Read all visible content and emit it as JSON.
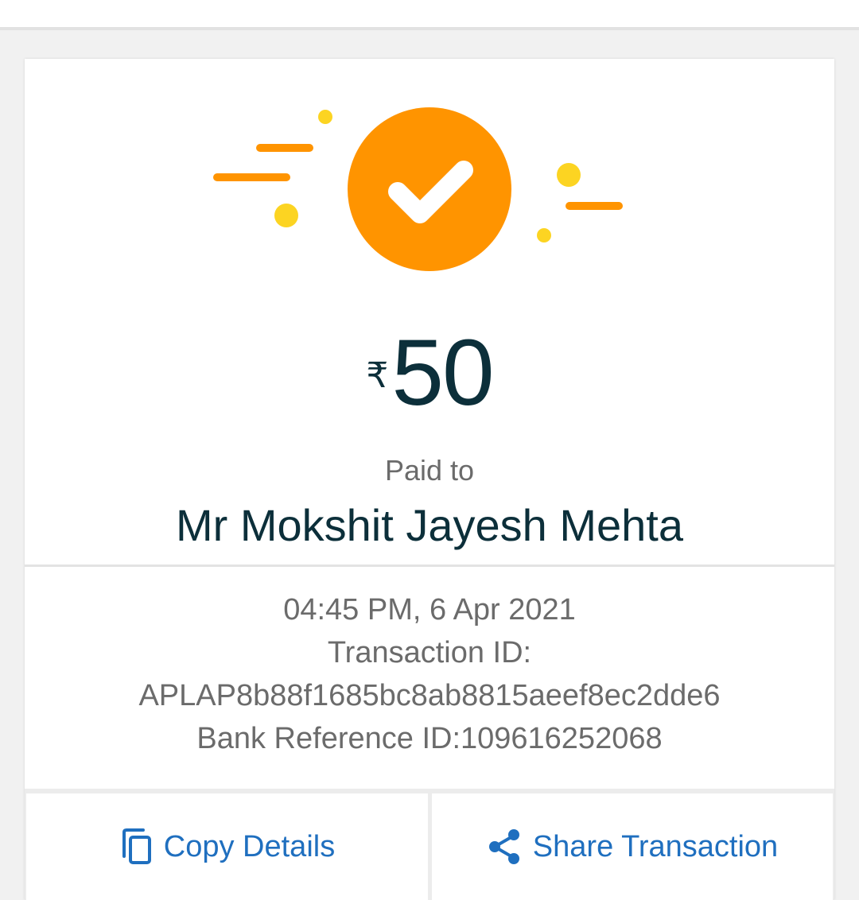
{
  "payment": {
    "currency_symbol": "₹",
    "amount": "50",
    "paid_label": "Paid to",
    "payee_name": "Mr Mokshit Jayesh Mehta"
  },
  "details": {
    "datetime": "04:45 PM, 6 Apr 2021",
    "transaction_label": "Transaction ID:",
    "transaction_id": "APLAP8b88f1685bc8ab8815aeef8ec2dde6",
    "bank_reference": "Bank Reference ID:109616252068"
  },
  "actions": {
    "copy_label": "Copy Details",
    "share_label": "Share Transaction",
    "copy_icon": "copy-icon",
    "share_icon": "share-icon"
  },
  "colors": {
    "success_orange": "#ff9400",
    "accent_yellow": "#fcd422",
    "link_blue": "#1f6fbf",
    "text_dark": "#0c2f3a",
    "text_muted": "#6b6b6b"
  }
}
